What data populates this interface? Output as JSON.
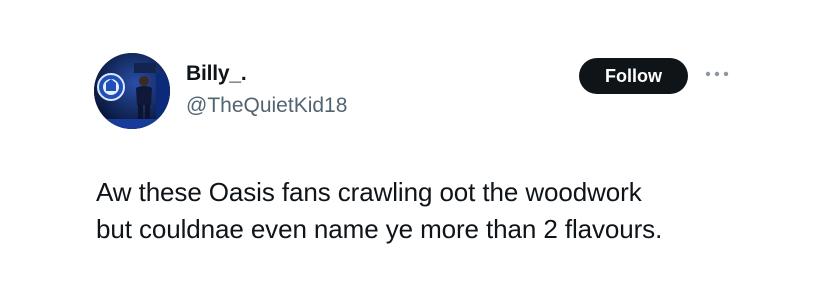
{
  "author": {
    "display_name": "Billy_.",
    "handle": "@TheQuietKid18"
  },
  "actions": {
    "follow_label": "Follow",
    "more_icon": "more-horizontal-icon"
  },
  "tweet": {
    "lines": [
      "Aw these Oasis fans crawling oot the woodwork",
      "but couldnae even name ye more than 2 flavours."
    ]
  },
  "colors": {
    "text": "#0f1419",
    "secondary_text": "#536471",
    "follow_bg": "#0f1419",
    "follow_text": "#ffffff",
    "avatar_bg": "#0a1c4a"
  }
}
